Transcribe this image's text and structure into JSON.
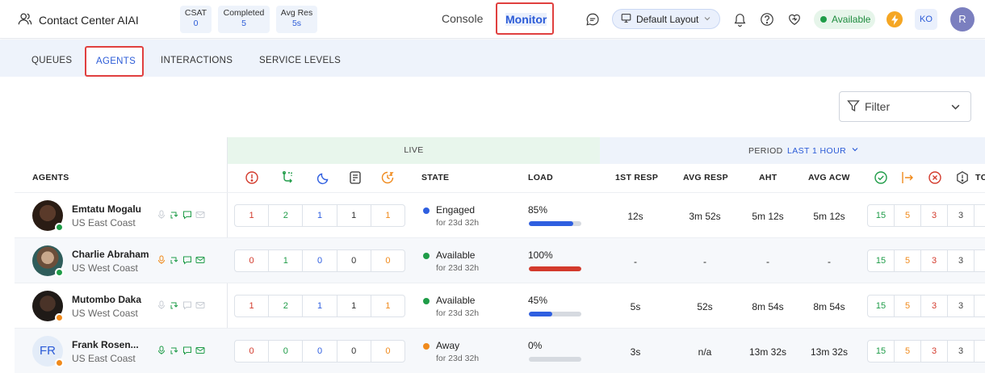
{
  "header": {
    "app_title": "Contact Center AIAI",
    "stats": [
      {
        "label": "CSAT",
        "value": "0"
      },
      {
        "label": "Completed",
        "value": "5"
      },
      {
        "label": "Avg Res",
        "value": "5s"
      }
    ],
    "nav_console": "Console",
    "nav_monitor": "Monitor",
    "layout_label": "Default Layout",
    "status_label": "Available",
    "user_initials": "KO",
    "avatar_initial": "R",
    "icons": [
      "users-icon",
      "chat-icon",
      "monitor-icon",
      "bell-icon",
      "help-icon",
      "heart-icon",
      "bolt-icon"
    ]
  },
  "tabs": [
    {
      "label": "QUEUES"
    },
    {
      "label": "AGENTS",
      "active": true
    },
    {
      "label": "INTERACTIONS"
    },
    {
      "label": "SERVICE LEVELS"
    }
  ],
  "filter": {
    "label": "Filter"
  },
  "bands": {
    "live": "LIVE",
    "period_label": "PERIOD",
    "period_value": "LAST 1 HOUR"
  },
  "columns": {
    "agents": "AGENTS",
    "state": "STATE",
    "load": "LOAD",
    "first_resp": "1ST RESP",
    "avg_resp": "AVG RESP",
    "aht": "AHT",
    "avg_acw": "AVG ACW",
    "truncated": "TC"
  },
  "agents": [
    {
      "name": "Emtatu Mogalu",
      "region": "US East Coast",
      "presence": "green",
      "live": [
        "1",
        "2",
        "1",
        "1",
        "1"
      ],
      "state": "Engaged",
      "state_color": "#2f5fe0",
      "state_for": "for 23d 32h",
      "load": "85%",
      "load_value": 0.85,
      "load_color": "#2f5fe0",
      "first_resp": "12s",
      "avg_resp": "3m 52s",
      "aht": "5m 12s",
      "avg_acw": "5m 12s",
      "period": [
        "15",
        "5",
        "3",
        "3"
      ]
    },
    {
      "name": "Charlie Abraham",
      "region": "US West Coast",
      "presence": "green",
      "live": [
        "0",
        "1",
        "0",
        "0",
        "0"
      ],
      "state": "Available",
      "state_color": "#1f9c48",
      "state_for": "for 23d 32h",
      "load": "100%",
      "load_value": 1.0,
      "load_color": "#d33a2c",
      "first_resp": "-",
      "avg_resp": "-",
      "aht": "-",
      "avg_acw": "-",
      "period": [
        "15",
        "5",
        "3",
        "3"
      ]
    },
    {
      "name": "Mutombo Daka",
      "region": "US West Coast",
      "presence": "orange",
      "live": [
        "1",
        "2",
        "1",
        "1",
        "1"
      ],
      "state": "Available",
      "state_color": "#1f9c48",
      "state_for": "for 23d 32h",
      "load": "45%",
      "load_value": 0.45,
      "load_color": "#2f5fe0",
      "first_resp": "5s",
      "avg_resp": "52s",
      "aht": "8m 54s",
      "avg_acw": "8m 54s",
      "period": [
        "15",
        "5",
        "3",
        "3"
      ]
    },
    {
      "name": "Frank Rosen...",
      "initials": "FR",
      "region": "US East Coast",
      "presence": "orange",
      "live": [
        "0",
        "0",
        "0",
        "0",
        "0"
      ],
      "state": "Away",
      "state_color": "#f08a1c",
      "state_for": "for 23d 32h",
      "load": "0%",
      "load_value": 0.0,
      "load_color": "#2f5fe0",
      "first_resp": "3s",
      "avg_resp": "n/a",
      "aht": "13m 32s",
      "avg_acw": "13m 32s",
      "period": [
        "15",
        "5",
        "3",
        "3"
      ]
    }
  ]
}
